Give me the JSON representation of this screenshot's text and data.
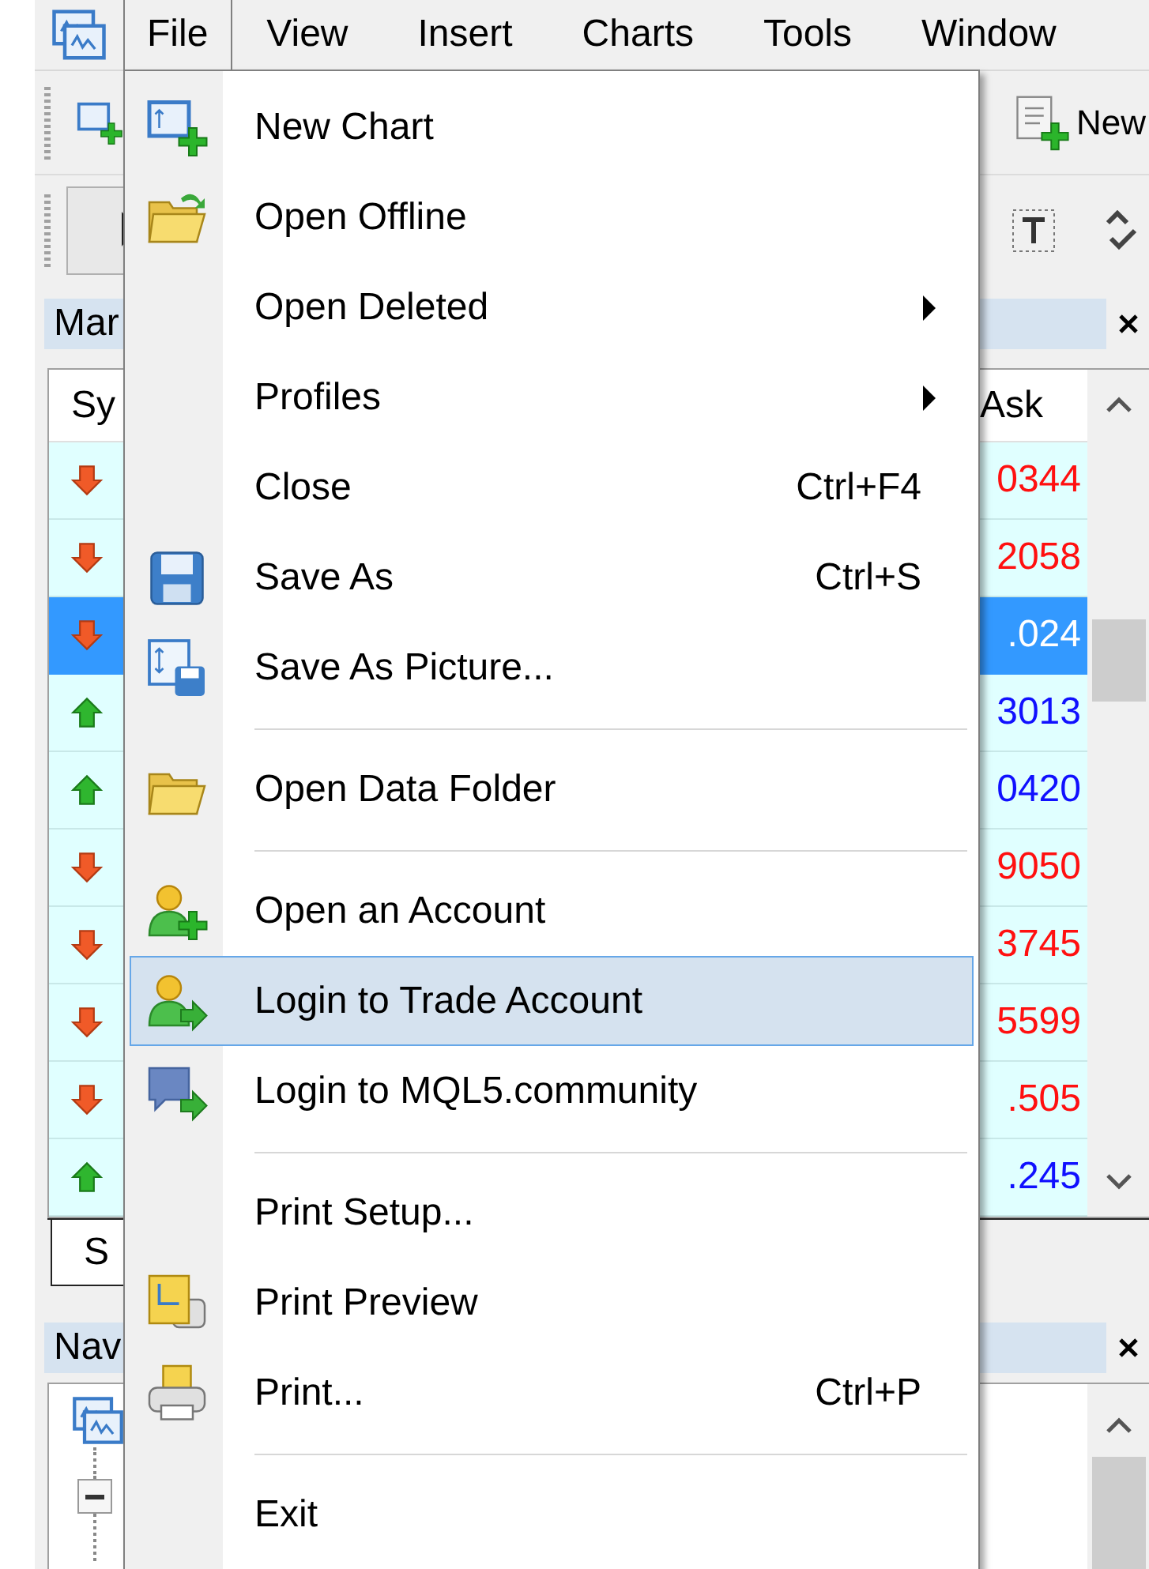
{
  "menubar": [
    {
      "label": "File",
      "selected": true
    },
    {
      "label": "View",
      "selected": false
    },
    {
      "label": "Insert",
      "selected": false
    },
    {
      "label": "Charts",
      "selected": false
    },
    {
      "label": "Tools",
      "selected": false
    },
    {
      "label": "Window",
      "selected": false
    }
  ],
  "toolbar": {
    "new_order_label": "New"
  },
  "market_watch": {
    "title": "Mar",
    "columns": [
      "Sy",
      "Ask"
    ],
    "rows": [
      {
        "kind": "down",
        "ask": "0344",
        "selected": false
      },
      {
        "kind": "down",
        "ask": "2058",
        "selected": false
      },
      {
        "kind": "down",
        "ask": ".024",
        "selected": true
      },
      {
        "kind": "up",
        "ask": "3013",
        "selected": false
      },
      {
        "kind": "up",
        "ask": "0420",
        "selected": false
      },
      {
        "kind": "down",
        "ask": "9050",
        "selected": false
      },
      {
        "kind": "down",
        "ask": "3745",
        "selected": false
      },
      {
        "kind": "down",
        "ask": "5599",
        "selected": false
      },
      {
        "kind": "down",
        "ask": ".505",
        "selected": false
      },
      {
        "kind": "up",
        "ask": ".245",
        "selected": false
      }
    ],
    "tab": "S"
  },
  "navigator": {
    "title": "Nav"
  },
  "file_menu": {
    "items": [
      {
        "kind": "item",
        "label": "New Chart",
        "submenu": false,
        "selected": false
      },
      {
        "kind": "item",
        "label": "Open Offline",
        "submenu": false,
        "selected": false
      },
      {
        "kind": "item",
        "label": "Open Deleted",
        "submenu": true,
        "selected": false
      },
      {
        "kind": "item",
        "label": "Profiles",
        "submenu": true,
        "selected": false
      },
      {
        "kind": "item",
        "label": "Close",
        "shortcut": "Ctrl+F4",
        "submenu": false,
        "selected": false
      },
      {
        "kind": "item",
        "label": "Save As",
        "shortcut": "Ctrl+S",
        "submenu": false,
        "selected": false
      },
      {
        "kind": "item",
        "label": "Save As Picture...",
        "submenu": false,
        "selected": false
      },
      {
        "kind": "separator"
      },
      {
        "kind": "item",
        "label": "Open Data Folder",
        "submenu": false,
        "selected": false
      },
      {
        "kind": "separator"
      },
      {
        "kind": "item",
        "label": "Open an Account",
        "submenu": false,
        "selected": false
      },
      {
        "kind": "item",
        "label": "Login to Trade Account",
        "submenu": false,
        "selected": true
      },
      {
        "kind": "item",
        "label": "Login to MQL5.community",
        "submenu": false,
        "selected": false
      },
      {
        "kind": "separator"
      },
      {
        "kind": "item",
        "label": "Print Setup...",
        "submenu": false,
        "selected": false
      },
      {
        "kind": "item",
        "label": "Print Preview",
        "submenu": false,
        "selected": false
      },
      {
        "kind": "item",
        "label": "Print...",
        "shortcut": "Ctrl+P",
        "submenu": false,
        "selected": false
      },
      {
        "kind": "separator"
      },
      {
        "kind": "item",
        "label": "Exit",
        "submenu": false,
        "selected": false
      }
    ]
  }
}
